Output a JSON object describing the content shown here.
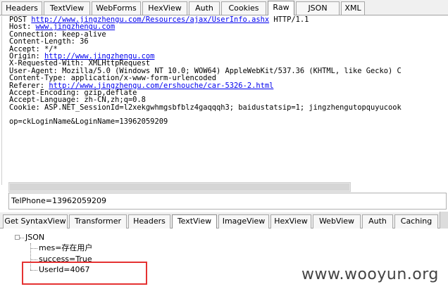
{
  "request_tabs": [
    "Headers",
    "TextView",
    "WebForms",
    "HexView",
    "Auth",
    "Cookies",
    "Raw",
    "JSON",
    "XML"
  ],
  "raw": {
    "method_line_prefix": "POST ",
    "method_line_url": "http://www.jingzhengu.com/Resources/ajax/UserInfo.ashx",
    "method_line_suffix": " HTTP/1.1",
    "host_label": "Host: ",
    "host_value": "www.jingzhengu.com",
    "connection": "Connection: keep-alive",
    "content_length": "Content-Length: 36",
    "accept": "Accept: */*",
    "origin_label": "Origin: ",
    "origin_value": "http://www.jingzhengu.com",
    "x_requested_with": "X-Requested-With: XMLHttpRequest",
    "user_agent": "User-Agent: Mozilla/5.0 (Windows NT 10.0; WOW64) AppleWebKit/537.36 (KHTML, like Gecko) C",
    "content_type": "Content-Type: application/x-www-form-urlencoded",
    "referer_label": "Referer: ",
    "referer_value": "http://www.jingzhengu.com/ershouche/car-5326-2.html",
    "accept_encoding": "Accept-Encoding: gzip,deflate",
    "accept_language": "Accept-Language: zh-CN,zh;q=0.8",
    "cookie": "Cookie: ASP.NET_SessionId=l2xekgwhmgsbfblz4gaqqqh3; baidustatsip=1; jingzhengutopquyucook",
    "body": "op=ckLoginName&LoginName=13962059209"
  },
  "selected_value": "TelPhone=13962059209",
  "response_tabs": [
    "Get SyntaxView",
    "Transformer",
    "Headers",
    "TextView",
    "ImageView",
    "HexView",
    "WebView",
    "Auth",
    "Caching"
  ],
  "tree": {
    "root": "JSON",
    "items": [
      "mes=存在用户",
      "success=True",
      "UserId=4067"
    ]
  },
  "watermark": "www.wooyun.org"
}
